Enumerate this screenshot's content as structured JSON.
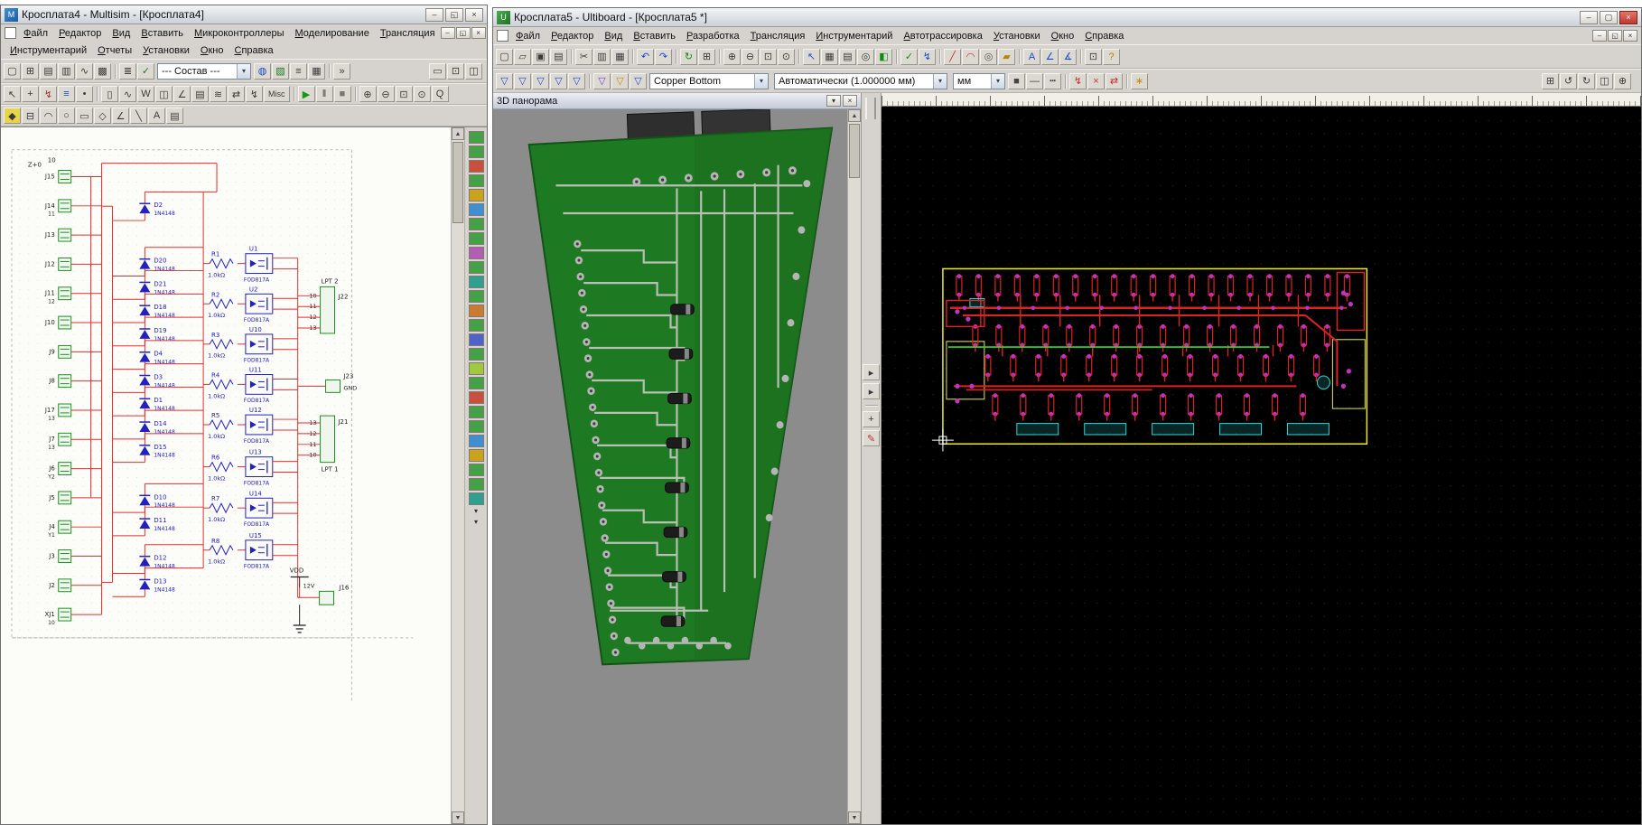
{
  "multisim": {
    "title": "Кросплата4 - Multisim - [Кросплата4]",
    "menu_row1": [
      {
        "id": "file",
        "label": "Файл"
      },
      {
        "id": "edit",
        "label": "Редактор"
      },
      {
        "id": "view",
        "label": "Вид"
      },
      {
        "id": "insert",
        "label": "Вставить"
      },
      {
        "id": "mcu",
        "label": "Микроконтроллеры"
      },
      {
        "id": "simulate",
        "label": "Моделирование"
      },
      {
        "id": "transfer",
        "label": "Трансляция"
      }
    ],
    "menu_row2": [
      {
        "id": "tools",
        "label": "Инструментарий"
      },
      {
        "id": "reports",
        "label": "Отчеты"
      },
      {
        "id": "options",
        "label": "Установки"
      },
      {
        "id": "window",
        "label": "Окно"
      },
      {
        "id": "help",
        "label": "Справка"
      }
    ],
    "combo_component": "--- Состав ---",
    "toolbar_main_left": [
      [
        {
          "name": "new-file-icon",
          "glyph": "▢"
        },
        {
          "name": "design-toolbox-icon",
          "glyph": "⊞"
        },
        {
          "name": "spreadsheet-view-icon",
          "glyph": "▤"
        },
        {
          "name": "database-manager-icon",
          "glyph": "▥"
        },
        {
          "name": "grapher-icon",
          "glyph": "∿"
        },
        {
          "name": "postprocessor-icon",
          "glyph": "▩"
        }
      ],
      [
        {
          "name": "hierarchy-icon",
          "glyph": "≣"
        },
        {
          "name": "electrical-rules-check-icon",
          "glyph": "✓",
          "color": "#1a7a1a"
        }
      ]
    ],
    "toolbar_main_mid": [
      [
        {
          "name": "virtual-components-icon",
          "glyph": "◍",
          "color": "#1a49c8"
        },
        {
          "name": "breadboard-view-icon",
          "glyph": "▧",
          "color": "#1a7a1a"
        },
        {
          "name": "ladder-diagram-icon",
          "glyph": "≡"
        },
        {
          "name": "mcu-window-icon",
          "glyph": "▦"
        }
      ],
      [
        {
          "name": "overflow-chevron-icon",
          "glyph": "»"
        }
      ]
    ],
    "toolbar_main_right": [
      [
        {
          "name": "description-box-icon",
          "glyph": "▭"
        },
        {
          "name": "zoom-sheet-icon",
          "glyph": "⊡"
        },
        {
          "name": "split-window-icon",
          "glyph": "◫"
        }
      ]
    ],
    "toolbar_sim": [
      [
        {
          "name": "pointer-icon",
          "glyph": "↖"
        },
        {
          "name": "pan-icon",
          "glyph": "+"
        },
        {
          "name": "wire-mode-icon",
          "glyph": "↯",
          "color": "#a33333"
        },
        {
          "name": "bus-mode-icon",
          "glyph": "≡",
          "color": "#1a49c8"
        },
        {
          "name": "junction-icon",
          "glyph": "•"
        }
      ],
      [
        {
          "name": "multimeter-icon",
          "glyph": "▯"
        },
        {
          "name": "function-generator-icon",
          "glyph": "∿"
        },
        {
          "name": "wattmeter-icon",
          "glyph": "W"
        },
        {
          "name": "oscilloscope-icon",
          "glyph": "◫"
        },
        {
          "name": "bode-plotter-icon",
          "glyph": "∠"
        },
        {
          "name": "word-generator-icon",
          "glyph": "▤"
        },
        {
          "name": "logic-analyzer-icon",
          "glyph": "≋"
        },
        {
          "name": "logic-converter-icon",
          "glyph": "⇄"
        },
        {
          "name": "iv-analyzer-icon",
          "glyph": "↯"
        },
        {
          "name": "misc-instruments-icon",
          "glyph": "Misc",
          "wide": true
        }
      ],
      [
        {
          "name": "run-icon",
          "glyph": "▶",
          "color": "#0f9b0f"
        },
        {
          "name": "pause-icon",
          "glyph": "‖"
        },
        {
          "name": "stop-icon",
          "glyph": "■",
          "color": "#777777"
        }
      ],
      [
        {
          "name": "zoom-in-icon",
          "glyph": "⊕"
        },
        {
          "name": "zoom-out-icon",
          "glyph": "⊖"
        },
        {
          "name": "zoom-area-icon",
          "glyph": "⊡"
        },
        {
          "name": "zoom-fit-icon",
          "glyph": "⊙"
        },
        {
          "name": "zoom-full-icon",
          "glyph": "Q"
        }
      ]
    ],
    "toolbar_draw": [
      [
        {
          "name": "in-use-list-icon",
          "glyph": "◆",
          "bg": "#e8d44a"
        },
        {
          "name": "hierarchical-block-icon",
          "glyph": "⊟"
        },
        {
          "name": "arc-icon",
          "glyph": "◠"
        },
        {
          "name": "ellipse-icon",
          "glyph": "○"
        },
        {
          "name": "rectangle-icon",
          "glyph": "▭"
        },
        {
          "name": "polygon-icon",
          "glyph": "◇"
        },
        {
          "name": "polyline-icon",
          "glyph": "∠"
        },
        {
          "name": "line-icon",
          "glyph": "╲"
        },
        {
          "name": "text-icon",
          "glyph": "A"
        },
        {
          "name": "comment-icon",
          "glyph": "▤"
        }
      ]
    ],
    "right_strip": [
      "#45a047",
      "#45a047",
      "#c94f3e",
      "#45a047",
      "#caa41f",
      "#3f8fd1",
      "#45a047",
      "#45a047",
      "#b05fb3",
      "#45a047",
      "#2f9f92",
      "#45a047",
      "#c97a33",
      "#45a047",
      "#4f62c9",
      "#45a047",
      "#9fc93f",
      "#45a047",
      "#c94f3e",
      "#45a047",
      "#45a047",
      "#3f8fd1",
      "#caa41f",
      "#45a047",
      "#45a047",
      "#2f9f92"
    ],
    "schematic": {
      "corner_label": "Z+0",
      "corner_value": "10",
      "diode_part": "1N4148",
      "opto_part": "FOD817A",
      "connectors": [
        {
          "name": "J15",
          "sub": ""
        },
        {
          "name": "J14",
          "sub": "11"
        },
        {
          "name": "J13",
          "sub": ""
        },
        {
          "name": "J12",
          "sub": ""
        },
        {
          "name": "J11",
          "sub": "12"
        },
        {
          "name": "J10",
          "sub": ""
        },
        {
          "name": "J9",
          "sub": ""
        },
        {
          "name": "J8",
          "sub": ""
        },
        {
          "name": "J17",
          "sub": "13"
        },
        {
          "name": "J7",
          "sub": "13"
        },
        {
          "name": "J6",
          "sub": "Y2"
        },
        {
          "name": "J5",
          "sub": ""
        },
        {
          "name": "J4",
          "sub": "Y1"
        },
        {
          "name": "J3",
          "sub": ""
        },
        {
          "name": "J2",
          "sub": ""
        },
        {
          "name": "XJ1",
          "sub": "10"
        }
      ],
      "diodes": [
        "D2",
        "D20",
        "D21",
        "D18",
        "D19",
        "D4",
        "D3",
        "D1",
        "D14",
        "D15",
        "D10",
        "D11",
        "D12",
        "D13"
      ],
      "opto_rows": [
        {
          "r": "R1",
          "v": "1.0kΩ",
          "u": "U1"
        },
        {
          "r": "R2",
          "v": "1.0kΩ",
          "u": "U2"
        },
        {
          "r": "R3",
          "v": "1.0kΩ",
          "u": "U10"
        },
        {
          "r": "R4",
          "v": "1.0kΩ",
          "u": "U11"
        },
        {
          "r": "R5",
          "v": "1.0kΩ",
          "u": "U12"
        },
        {
          "r": "R6",
          "v": "1.0kΩ",
          "u": "U13"
        },
        {
          "r": "R7",
          "v": "1.0kΩ",
          "u": "U14"
        },
        {
          "r": "R8",
          "v": "1.0kΩ",
          "u": "U15"
        }
      ],
      "right": {
        "lpt2": "LPT 2",
        "j22": "J22",
        "j22_pins": [
          "10",
          "11",
          "12",
          "13"
        ],
        "j23": "J23",
        "gnd": "GND",
        "j21": "J21",
        "j21_pins": [
          "13",
          "12",
          "11",
          "10"
        ],
        "lpt1": "LPT 1",
        "vdd": "VDD",
        "vdd_value": "12V",
        "j16": "J16"
      }
    }
  },
  "ultiboard": {
    "title": "Кросплата5 - Ultiboard - [Кросплата5 *]",
    "panel3d_title": "3D панорама",
    "layer_combo": "Copper Bottom",
    "grid_combo": "Автоматически (1.000000 мм)",
    "units_combo": "мм",
    "menu": [
      {
        "id": "file",
        "label": "Файл"
      },
      {
        "id": "edit",
        "label": "Редактор"
      },
      {
        "id": "view",
        "label": "Вид"
      },
      {
        "id": "insert",
        "label": "Вставить"
      },
      {
        "id": "design",
        "label": "Разработка"
      },
      {
        "id": "transfer",
        "label": "Трансляция"
      },
      {
        "id": "tools",
        "label": "Инструментарий"
      },
      {
        "id": "autoroute",
        "label": "Автотрассировка"
      },
      {
        "id": "options",
        "label": "Установки"
      },
      {
        "id": "window",
        "label": "Окно"
      },
      {
        "id": "help",
        "label": "Справка"
      }
    ],
    "toolbar_main": [
      [
        {
          "name": "new-file-icon",
          "glyph": "▢"
        },
        {
          "name": "open-file-icon",
          "glyph": "▱"
        },
        {
          "name": "save-file-icon",
          "glyph": "▣"
        },
        {
          "name": "print-icon",
          "glyph": "▤"
        }
      ],
      [
        {
          "name": "cut-icon",
          "glyph": "✂"
        },
        {
          "name": "copy-icon",
          "glyph": "▥"
        },
        {
          "name": "paste-icon",
          "glyph": "▦"
        }
      ],
      [
        {
          "name": "undo-icon",
          "glyph": "↶",
          "color": "#1a49c8"
        },
        {
          "name": "redo-icon",
          "glyph": "↷",
          "color": "#1a49c8"
        }
      ],
      [
        {
          "name": "refresh-icon",
          "glyph": "↻",
          "color": "#0f8b0f"
        },
        {
          "name": "grid-toggle-icon",
          "glyph": "⊞"
        }
      ],
      [
        {
          "name": "zoom-in-icon",
          "glyph": "⊕"
        },
        {
          "name": "zoom-out-icon",
          "glyph": "⊖"
        },
        {
          "name": "zoom-window-icon",
          "glyph": "⊡"
        },
        {
          "name": "zoom-full-icon",
          "glyph": "⊙"
        }
      ],
      [
        {
          "name": "select-icon",
          "glyph": "↖",
          "color": "#2255cc"
        },
        {
          "name": "spreadsheet-view-icon",
          "glyph": "▦"
        },
        {
          "name": "part-table-icon",
          "glyph": "▤"
        },
        {
          "name": "birds-eye-icon",
          "glyph": "◎"
        },
        {
          "name": "board-3d-icon",
          "glyph": "◧",
          "color": "#0f8b0f"
        }
      ],
      [
        {
          "name": "drc-check-icon",
          "glyph": "✓",
          "color": "#0f8b0f"
        },
        {
          "name": "connectivity-check-icon",
          "glyph": "↯",
          "color": "#1a49c8"
        }
      ],
      [
        {
          "name": "place-line-icon",
          "glyph": "╱",
          "color": "#c23030"
        },
        {
          "name": "place-arc-icon",
          "glyph": "◠",
          "color": "#c23030"
        },
        {
          "name": "place-via-icon",
          "glyph": "◎",
          "color": "#555555"
        },
        {
          "name": "copper-pour-icon",
          "glyph": "▰",
          "color": "#b8860b"
        }
      ],
      [
        {
          "name": "text-tool-icon",
          "glyph": "A",
          "color": "#1a49c8"
        },
        {
          "name": "dimension-icon",
          "glyph": "∠",
          "color": "#1a49c8"
        },
        {
          "name": "measure-icon",
          "glyph": "∡",
          "color": "#1a49c8"
        }
      ],
      [
        {
          "name": "selection-rect-icon",
          "glyph": "⊡"
        },
        {
          "name": "help-icon",
          "glyph": "?",
          "color": "#b8860b"
        }
      ]
    ],
    "toolbar_filters": [
      [
        {
          "name": "filter-all-icon",
          "glyph": "▽",
          "color": "#2244cc"
        },
        {
          "name": "filter-parts-icon",
          "glyph": "▽",
          "color": "#2244cc"
        },
        {
          "name": "filter-traces-icon",
          "glyph": "▽",
          "color": "#2244cc"
        },
        {
          "name": "filter-vias-icon",
          "glyph": "▽",
          "color": "#2244cc"
        },
        {
          "name": "filter-pads-icon",
          "glyph": "▽",
          "color": "#2244cc"
        }
      ],
      [
        {
          "name": "filter-copper-icon",
          "glyph": "▽",
          "color": "#7a3fd1"
        },
        {
          "name": "filter-smd-icon",
          "glyph": "▽",
          "color": "#c88a00"
        },
        {
          "name": "filter-attributes-icon",
          "glyph": "▽",
          "color": "#2244cc"
        }
      ]
    ],
    "toolbar_edit_extras": [
      [
        {
          "name": "color-swatch",
          "glyph": "■",
          "color": "#444444"
        },
        {
          "name": "line-width-icon",
          "glyph": "—"
        },
        {
          "name": "line-style-icon",
          "glyph": "┅"
        }
      ],
      [
        {
          "name": "unroute-icon",
          "glyph": "↯",
          "color": "#c23030"
        },
        {
          "name": "delete-trace-icon",
          "glyph": "×",
          "color": "#c23030"
        },
        {
          "name": "net-swap-icon",
          "glyph": "⇄",
          "color": "#c23030"
        }
      ],
      [
        {
          "name": "ratsnest-icon",
          "glyph": "∗",
          "color": "#c88a00"
        }
      ]
    ],
    "toolbar_far_right": [
      [
        {
          "name": "placement-grid-icon",
          "glyph": "⊞"
        },
        {
          "name": "rotate-ccw-icon",
          "glyph": "↺"
        },
        {
          "name": "rotate-cw-icon",
          "glyph": "↻"
        },
        {
          "name": "flip-horizontal-icon",
          "glyph": "◫"
        },
        {
          "name": "anchor-icon",
          "glyph": "⊕"
        }
      ]
    ],
    "mid_toolbar": [
      [
        {
          "name": "panel-collapse-icon",
          "glyph": "▸"
        },
        {
          "name": "panel-collapse-alt-icon",
          "glyph": "▸"
        }
      ],
      [
        {
          "name": "pan-hand-icon",
          "glyph": "+"
        },
        {
          "name": "red-pen-icon",
          "glyph": "✎",
          "color": "#c23030"
        }
      ]
    ]
  }
}
